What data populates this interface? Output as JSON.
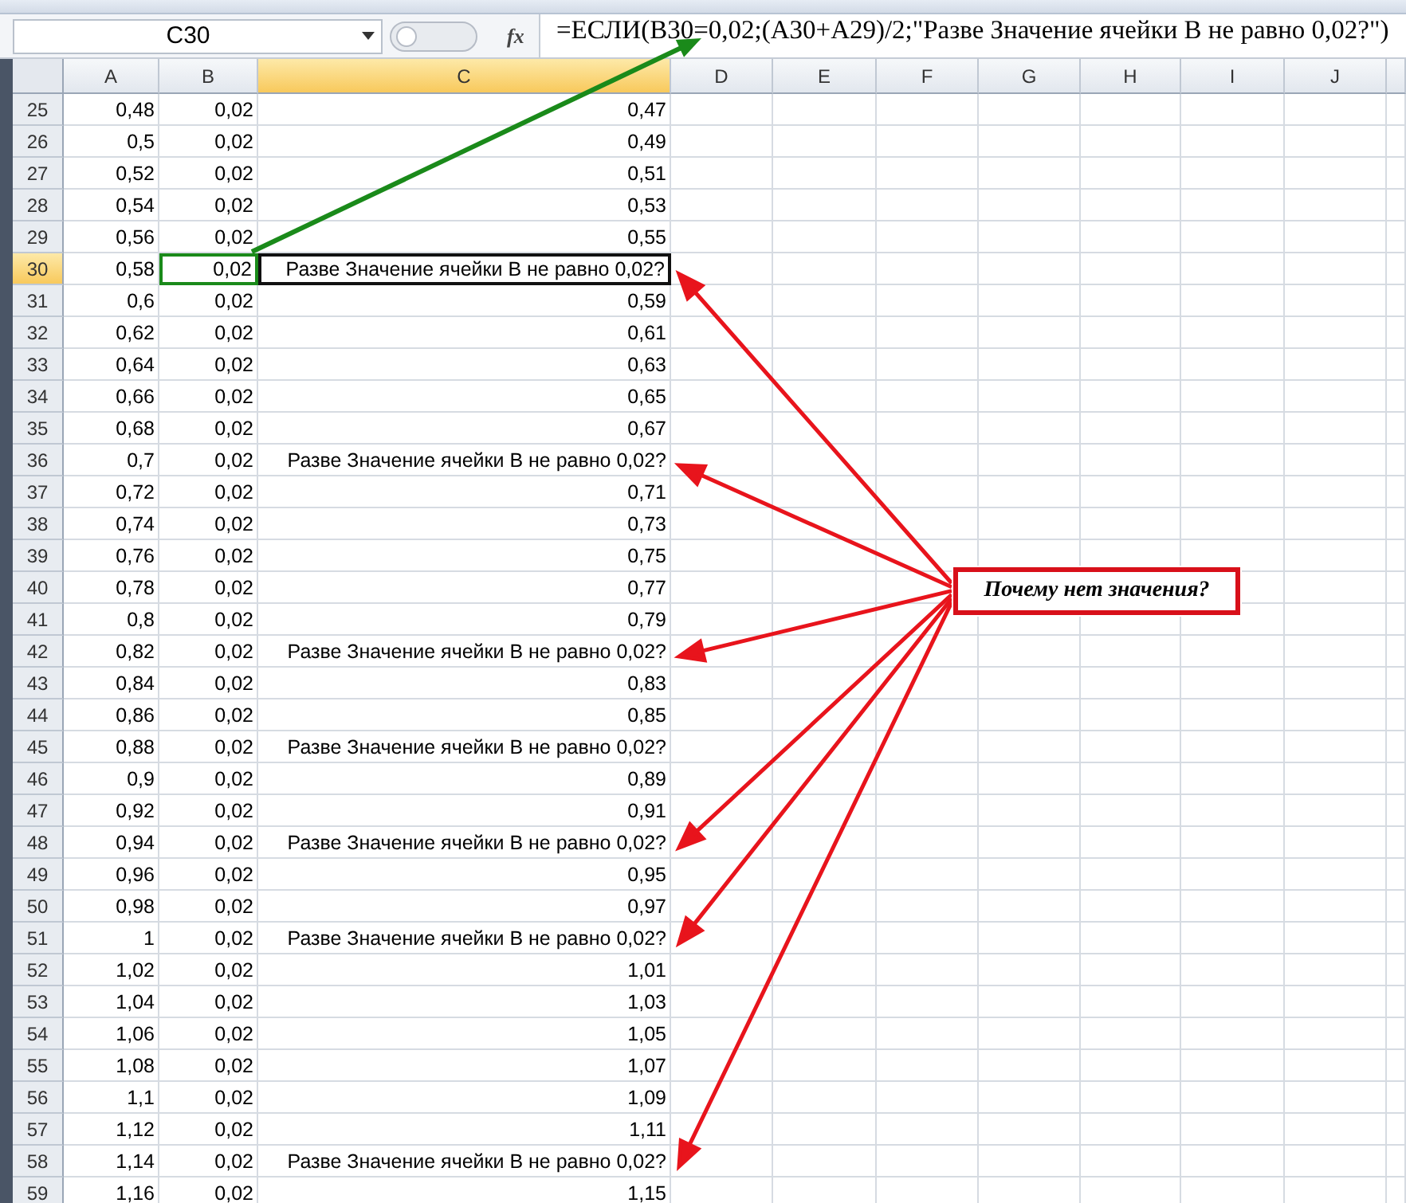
{
  "formula_bar": {
    "name_box": "C30",
    "fx": "fx",
    "formula": "=ЕСЛИ(B30=0,02;(A30+A29)/2;\"Разве Значение ячейки В не равно 0,02?\")"
  },
  "columns": [
    {
      "label": "A",
      "selected": false
    },
    {
      "label": "B",
      "selected": false
    },
    {
      "label": "C",
      "selected": true
    },
    {
      "label": "D",
      "selected": false
    },
    {
      "label": "E",
      "selected": false
    },
    {
      "label": "F",
      "selected": false
    },
    {
      "label": "G",
      "selected": false
    },
    {
      "label": "H",
      "selected": false
    },
    {
      "label": "I",
      "selected": false
    },
    {
      "label": "J",
      "selected": false
    }
  ],
  "rows": [
    {
      "n": "25",
      "a": "0,48",
      "b": "0,02",
      "c": "0,47",
      "selected": false,
      "b_outlined": false,
      "flagged": false
    },
    {
      "n": "26",
      "a": "0,5",
      "b": "0,02",
      "c": "0,49",
      "selected": false,
      "b_outlined": false,
      "flagged": false
    },
    {
      "n": "27",
      "a": "0,52",
      "b": "0,02",
      "c": "0,51",
      "selected": false,
      "b_outlined": false,
      "flagged": false
    },
    {
      "n": "28",
      "a": "0,54",
      "b": "0,02",
      "c": "0,53",
      "selected": false,
      "b_outlined": false,
      "flagged": false
    },
    {
      "n": "29",
      "a": "0,56",
      "b": "0,02",
      "c": "0,55",
      "selected": false,
      "b_outlined": false,
      "flagged": false
    },
    {
      "n": "30",
      "a": "0,58",
      "b": "0,02",
      "c": "Разве Значение ячейки В не равно 0,02?",
      "selected": true,
      "b_outlined": true,
      "flagged": true
    },
    {
      "n": "31",
      "a": "0,6",
      "b": "0,02",
      "c": "0,59",
      "selected": false,
      "b_outlined": false,
      "flagged": false
    },
    {
      "n": "32",
      "a": "0,62",
      "b": "0,02",
      "c": "0,61",
      "selected": false,
      "b_outlined": false,
      "flagged": false
    },
    {
      "n": "33",
      "a": "0,64",
      "b": "0,02",
      "c": "0,63",
      "selected": false,
      "b_outlined": false,
      "flagged": false
    },
    {
      "n": "34",
      "a": "0,66",
      "b": "0,02",
      "c": "0,65",
      "selected": false,
      "b_outlined": false,
      "flagged": false
    },
    {
      "n": "35",
      "a": "0,68",
      "b": "0,02",
      "c": "0,67",
      "selected": false,
      "b_outlined": false,
      "flagged": false
    },
    {
      "n": "36",
      "a": "0,7",
      "b": "0,02",
      "c": "Разве Значение ячейки В не равно 0,02?",
      "selected": false,
      "b_outlined": false,
      "flagged": true
    },
    {
      "n": "37",
      "a": "0,72",
      "b": "0,02",
      "c": "0,71",
      "selected": false,
      "b_outlined": false,
      "flagged": false
    },
    {
      "n": "38",
      "a": "0,74",
      "b": "0,02",
      "c": "0,73",
      "selected": false,
      "b_outlined": false,
      "flagged": false
    },
    {
      "n": "39",
      "a": "0,76",
      "b": "0,02",
      "c": "0,75",
      "selected": false,
      "b_outlined": false,
      "flagged": false
    },
    {
      "n": "40",
      "a": "0,78",
      "b": "0,02",
      "c": "0,77",
      "selected": false,
      "b_outlined": false,
      "flagged": false
    },
    {
      "n": "41",
      "a": "0,8",
      "b": "0,02",
      "c": "0,79",
      "selected": false,
      "b_outlined": false,
      "flagged": false
    },
    {
      "n": "42",
      "a": "0,82",
      "b": "0,02",
      "c": "Разве Значение ячейки В не равно 0,02?",
      "selected": false,
      "b_outlined": false,
      "flagged": true
    },
    {
      "n": "43",
      "a": "0,84",
      "b": "0,02",
      "c": "0,83",
      "selected": false,
      "b_outlined": false,
      "flagged": false
    },
    {
      "n": "44",
      "a": "0,86",
      "b": "0,02",
      "c": "0,85",
      "selected": false,
      "b_outlined": false,
      "flagged": false
    },
    {
      "n": "45",
      "a": "0,88",
      "b": "0,02",
      "c": "Разве Значение ячейки В не равно 0,02?",
      "selected": false,
      "b_outlined": false,
      "flagged": false
    },
    {
      "n": "46",
      "a": "0,9",
      "b": "0,02",
      "c": "0,89",
      "selected": false,
      "b_outlined": false,
      "flagged": false
    },
    {
      "n": "47",
      "a": "0,92",
      "b": "0,02",
      "c": "0,91",
      "selected": false,
      "b_outlined": false,
      "flagged": false
    },
    {
      "n": "48",
      "a": "0,94",
      "b": "0,02",
      "c": "Разве Значение ячейки В не равно 0,02?",
      "selected": false,
      "b_outlined": false,
      "flagged": true
    },
    {
      "n": "49",
      "a": "0,96",
      "b": "0,02",
      "c": "0,95",
      "selected": false,
      "b_outlined": false,
      "flagged": false
    },
    {
      "n": "50",
      "a": "0,98",
      "b": "0,02",
      "c": "0,97",
      "selected": false,
      "b_outlined": false,
      "flagged": false
    },
    {
      "n": "51",
      "a": "1",
      "b": "0,02",
      "c": "Разве Значение ячейки В не равно 0,02?",
      "selected": false,
      "b_outlined": false,
      "flagged": true
    },
    {
      "n": "52",
      "a": "1,02",
      "b": "0,02",
      "c": "1,01",
      "selected": false,
      "b_outlined": false,
      "flagged": false
    },
    {
      "n": "53",
      "a": "1,04",
      "b": "0,02",
      "c": "1,03",
      "selected": false,
      "b_outlined": false,
      "flagged": false
    },
    {
      "n": "54",
      "a": "1,06",
      "b": "0,02",
      "c": "1,05",
      "selected": false,
      "b_outlined": false,
      "flagged": false
    },
    {
      "n": "55",
      "a": "1,08",
      "b": "0,02",
      "c": "1,07",
      "selected": false,
      "b_outlined": false,
      "flagged": false
    },
    {
      "n": "56",
      "a": "1,1",
      "b": "0,02",
      "c": "1,09",
      "selected": false,
      "b_outlined": false,
      "flagged": false
    },
    {
      "n": "57",
      "a": "1,12",
      "b": "0,02",
      "c": "1,11",
      "selected": false,
      "b_outlined": false,
      "flagged": false
    },
    {
      "n": "58",
      "a": "1,14",
      "b": "0,02",
      "c": "Разве Значение ячейки В не равно 0,02?",
      "selected": false,
      "b_outlined": false,
      "flagged": true
    },
    {
      "n": "59",
      "a": "1,16",
      "b": "0,02",
      "c": "1,15",
      "selected": false,
      "b_outlined": false,
      "flagged": false
    }
  ],
  "callout": "Почему нет значения?"
}
